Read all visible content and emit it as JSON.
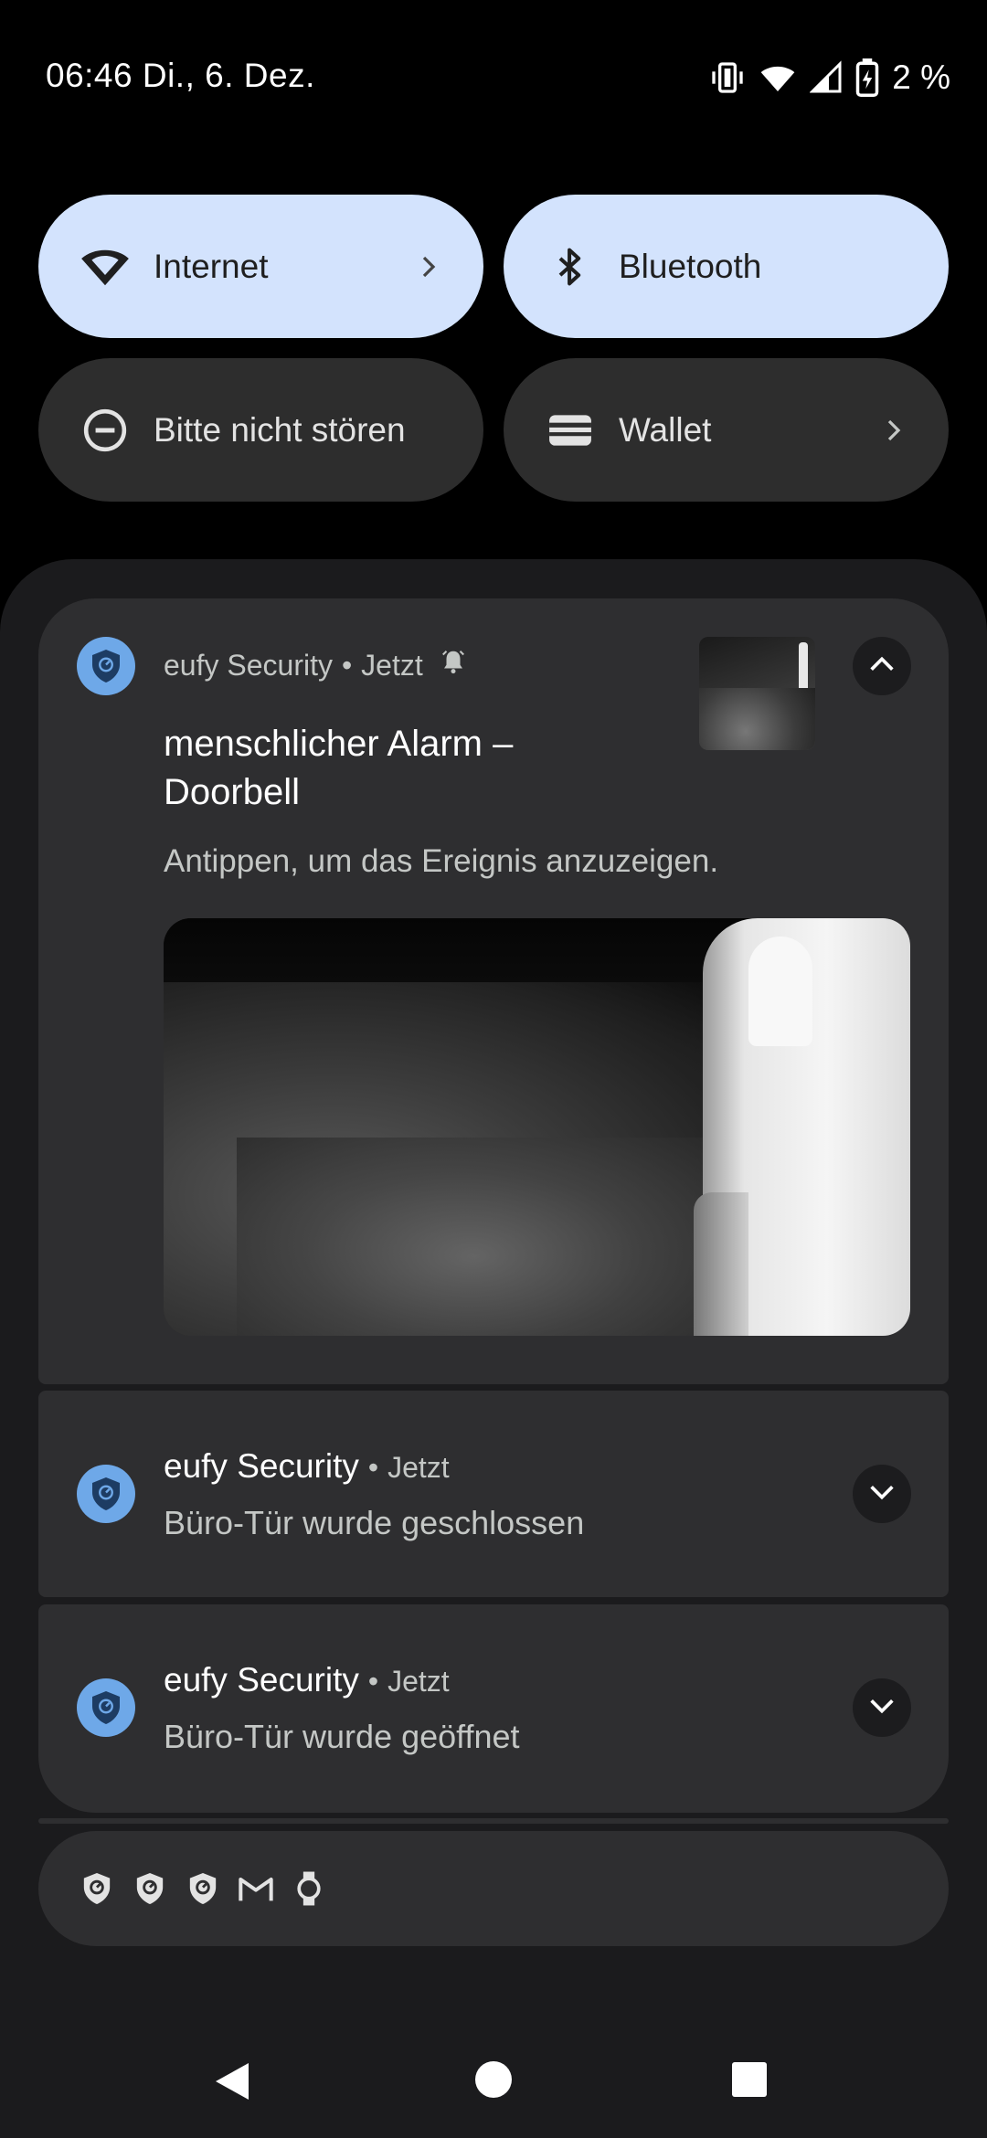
{
  "status_bar": {
    "time_date": "06:46 Di., 6. Dez.",
    "battery_percent": "2 %",
    "icons": [
      "vibrate-icon",
      "wifi-icon",
      "cellular-signal-icon",
      "battery-charging-icon"
    ]
  },
  "quick_settings": {
    "internet": {
      "label": "Internet",
      "icon": "wifi-icon",
      "state": "on",
      "has_chevron": true
    },
    "bluetooth": {
      "label": "Bluetooth",
      "icon": "bluetooth-icon",
      "state": "on",
      "has_chevron": false
    },
    "dnd": {
      "label": "Bitte nicht stören",
      "icon": "do-not-disturb-icon",
      "state": "off",
      "has_chevron": false
    },
    "wallet": {
      "label": "Wallet",
      "icon": "wallet-icon",
      "state": "off",
      "has_chevron": true
    }
  },
  "notifications": [
    {
      "app": "eufy Security",
      "time": "Jetzt",
      "separator": "•",
      "title": "menschlicher Alarm –\nDoorbell",
      "text": "Antippen, um das Ereignis anzuzeigen.",
      "expanded": true,
      "has_image": true
    },
    {
      "app": "eufy Security",
      "time": "Jetzt",
      "separator": "•",
      "text": "Büro-Tür wurde geschlossen",
      "expanded": false
    },
    {
      "app": "eufy Security",
      "time": "Jetzt",
      "separator": "•",
      "text": "Büro-Tür wurde geöffnet",
      "expanded": false
    }
  ],
  "summary_icons": [
    "eufy-shield-icon",
    "eufy-shield-icon",
    "eufy-shield-icon",
    "gmail-icon",
    "watch-icon"
  ],
  "nav": [
    "back-icon",
    "home-icon",
    "recents-icon"
  ],
  "colors": {
    "tile_on": "#d3e3fd",
    "tile_off": "#2d2d2d",
    "card": "#2e2e30",
    "shade": "#1b1b1d",
    "app_badge": "#6ea8e8"
  }
}
